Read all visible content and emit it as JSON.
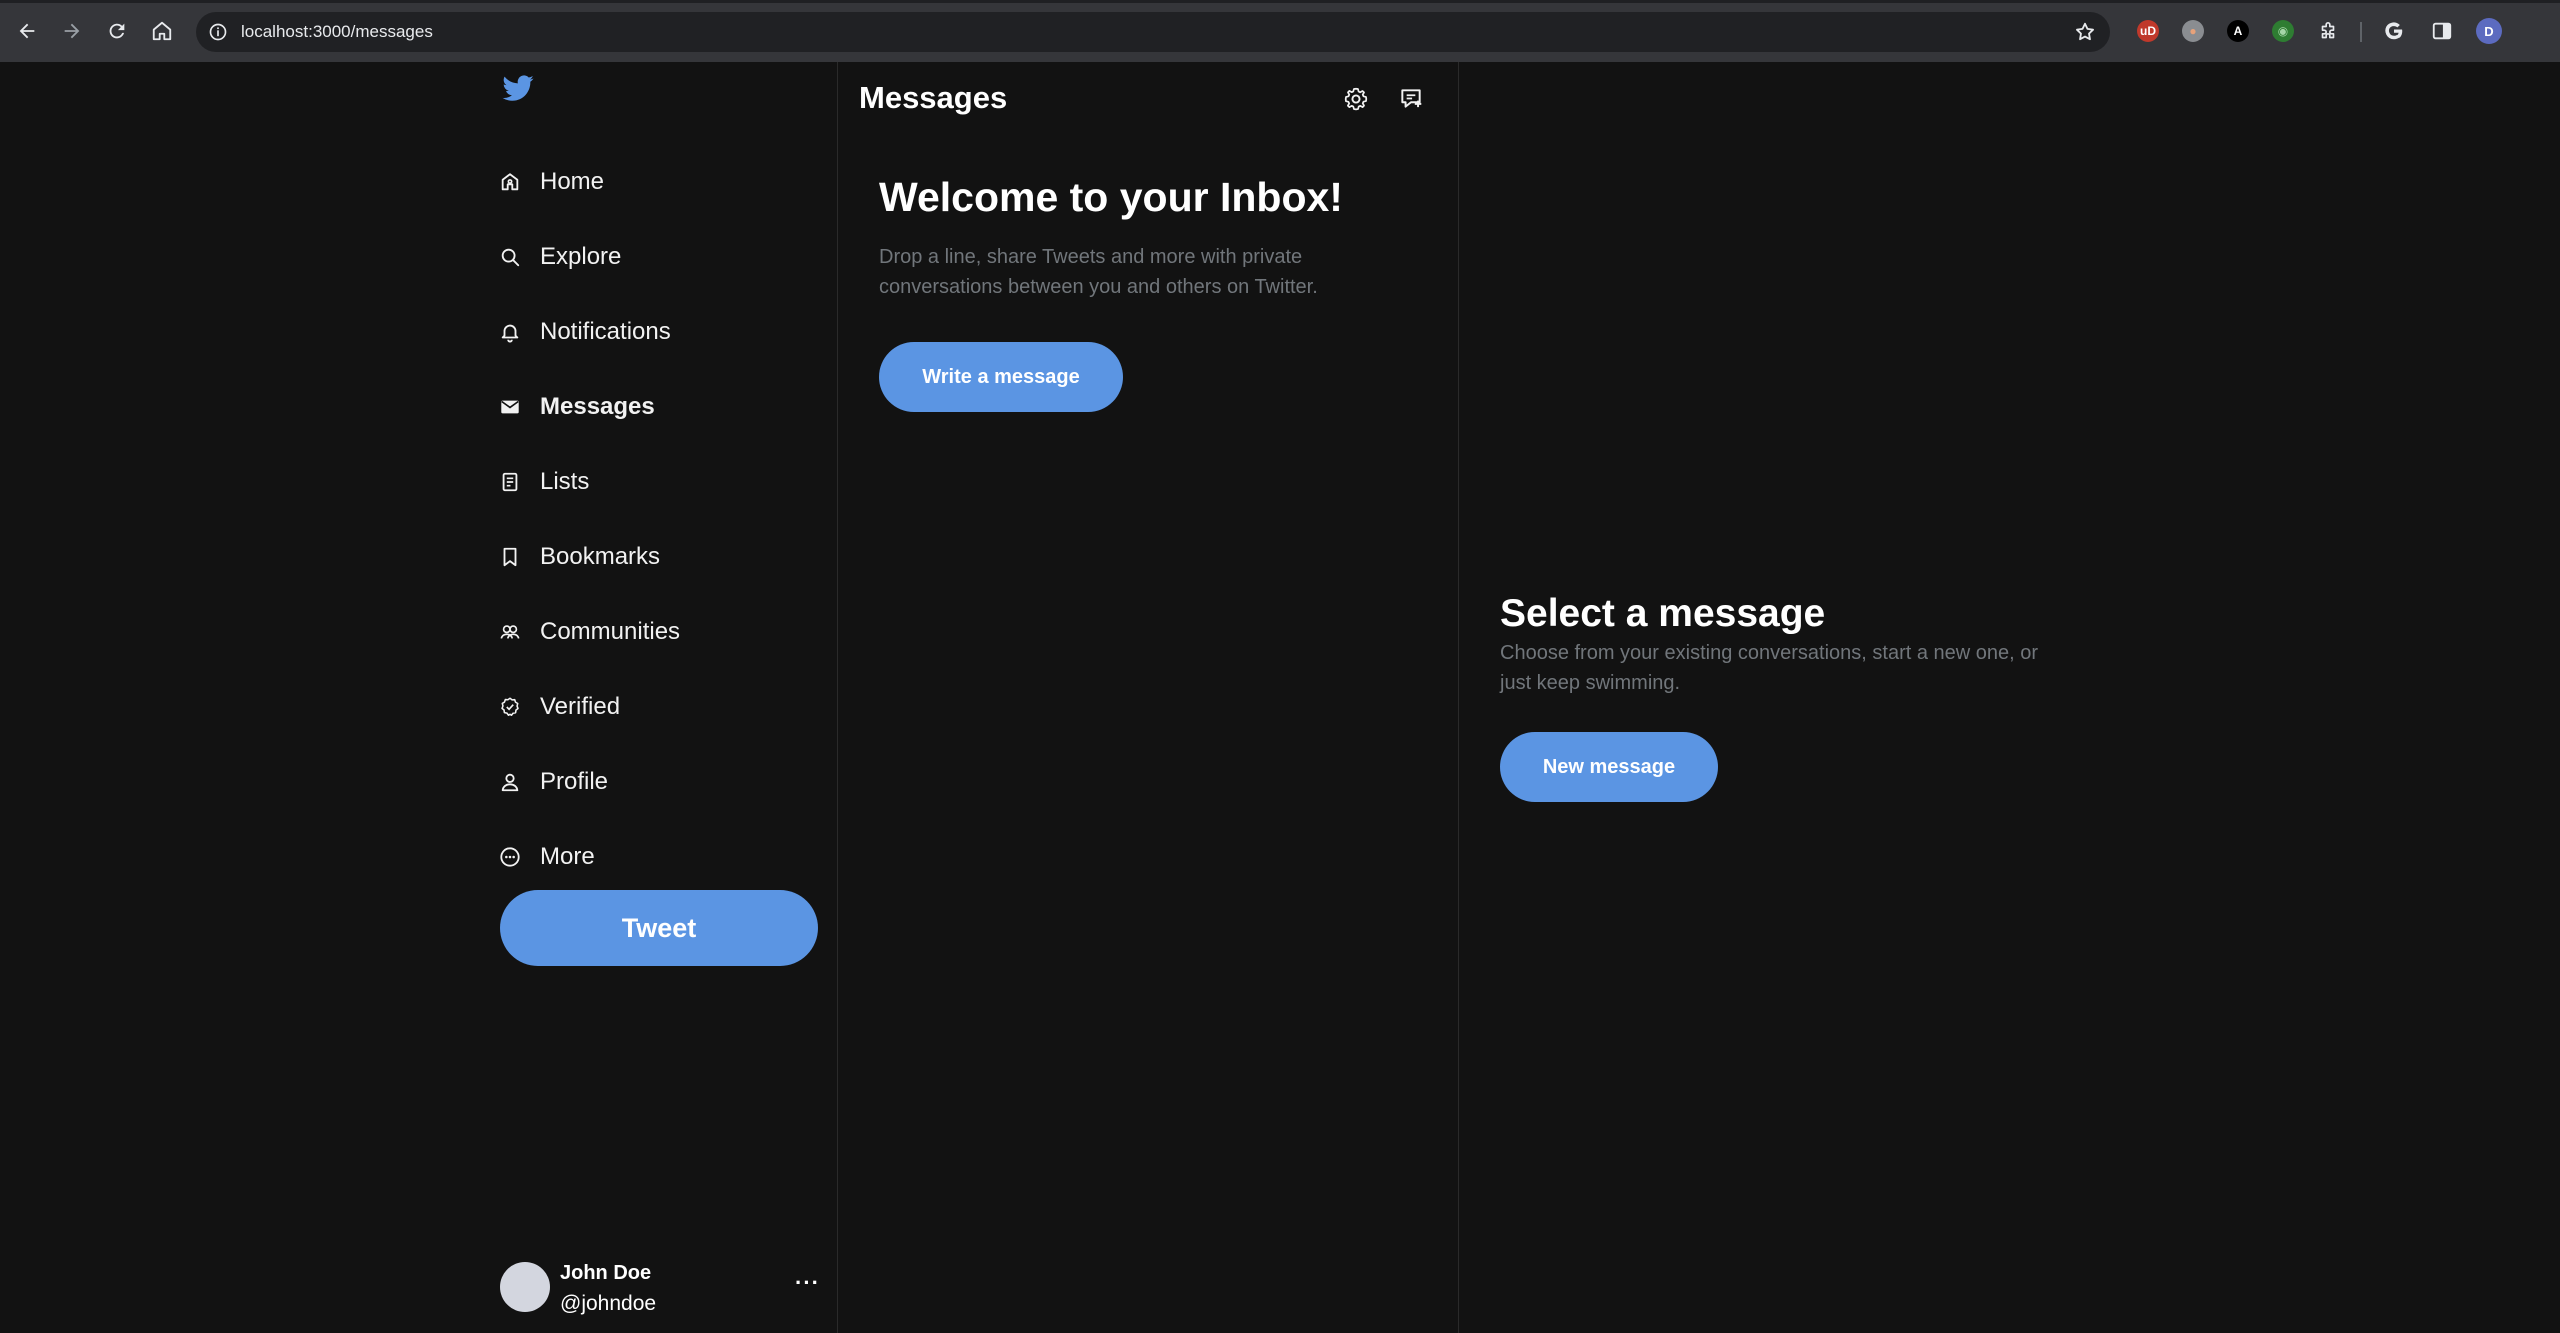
{
  "browser": {
    "url": "localhost:3000/messages",
    "extensions": [
      {
        "name": "ublock-icon",
        "text": "uD",
        "bg": "#c0392b",
        "fg": "#ffffff"
      },
      {
        "name": "cookie-icon",
        "text": "●",
        "bg": "#8a8d91",
        "fg": "#e8a27a"
      },
      {
        "name": "font-a-icon",
        "text": "A",
        "bg": "#000000",
        "fg": "#ffffff"
      },
      {
        "name": "target-icon",
        "text": "◉",
        "bg": "#2e7d32",
        "fg": "#a5d6a7"
      }
    ],
    "profile_initial": "D"
  },
  "sidebar": {
    "items": [
      {
        "label": "Home",
        "icon": "home-icon",
        "active": false
      },
      {
        "label": "Explore",
        "icon": "search-icon",
        "active": false
      },
      {
        "label": "Notifications",
        "icon": "bell-icon",
        "active": false
      },
      {
        "label": "Messages",
        "icon": "envelope-icon",
        "active": true
      },
      {
        "label": "Lists",
        "icon": "list-icon",
        "active": false
      },
      {
        "label": "Bookmarks",
        "icon": "bookmark-icon",
        "active": false
      },
      {
        "label": "Communities",
        "icon": "communities-icon",
        "active": false
      },
      {
        "label": "Verified",
        "icon": "verified-icon",
        "active": false
      },
      {
        "label": "Profile",
        "icon": "user-icon",
        "active": false
      },
      {
        "label": "More",
        "icon": "more-circle-icon",
        "active": false
      }
    ],
    "tweet_label": "Tweet",
    "user": {
      "name": "John Doe",
      "handle": "@johndoe",
      "more": "···"
    }
  },
  "messages": {
    "title": "Messages",
    "inbox_title": "Welcome to your Inbox!",
    "inbox_text": "Drop a line, share Tweets and more with private conversations between you and others on Twitter.",
    "write_label": "Write a message"
  },
  "detail": {
    "title": "Select a message",
    "text": "Choose from your existing conversations, start a new one, or just keep swimming.",
    "new_label": "New message"
  },
  "colors": {
    "accent": "#5b95e3",
    "background": "#121212",
    "muted_text": "#71767b",
    "border": "#2a2a2a"
  }
}
